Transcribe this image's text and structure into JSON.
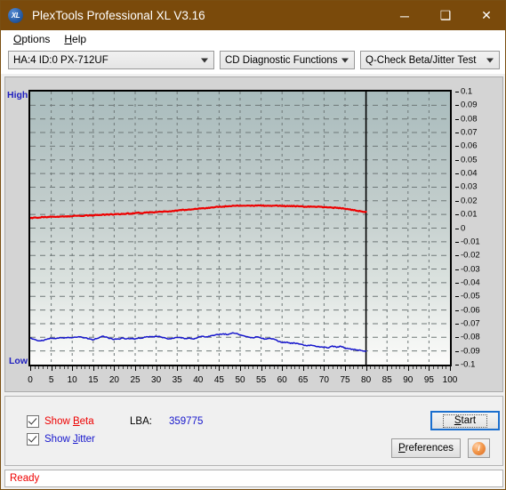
{
  "window": {
    "title": "PlexTools Professional XL V3.16",
    "icon": "xl-app-icon",
    "icon_text": "XL",
    "minimize_label": "─",
    "maximize_label": "❑",
    "close_label": "✕",
    "titlebar_color": "#7a4a0b"
  },
  "menu": {
    "items": [
      {
        "label": "Options",
        "accel": "O"
      },
      {
        "label": "Help",
        "accel": "H"
      }
    ]
  },
  "toolbar": {
    "drive_select": {
      "value": "HA:4 ID:0  PX-712UF",
      "options": [
        "HA:4 ID:0  PX-712UF"
      ]
    },
    "function_select": {
      "value": "CD Diagnostic Functions",
      "options": [
        "CD Diagnostic Functions"
      ]
    },
    "test_select": {
      "value": "Q-Check Beta/Jitter Test",
      "options": [
        "Q-Check Beta/Jitter Test"
      ]
    }
  },
  "controls": {
    "show_beta": {
      "label": "Show Beta",
      "accel": "B",
      "checked": true,
      "color": "#ee0000"
    },
    "show_jitter": {
      "label": "Show Jitter",
      "accel": "J",
      "checked": true,
      "color": "#1515cc"
    },
    "lba_label": "LBA:",
    "lba_value": "359775",
    "start_label": "Start",
    "start_accel": "S",
    "preferences_label": "Preferences",
    "preferences_accel": "P",
    "info_icon": "info-icon",
    "info_glyph": "i"
  },
  "status": {
    "text": "Ready"
  },
  "chart_data": {
    "type": "line",
    "title": "",
    "xlabel": "",
    "ylabel": "",
    "xlim": [
      0,
      100
    ],
    "ylim": [
      -0.1,
      0.1
    ],
    "grid": true,
    "legend": "none",
    "y_left_labels": {
      "top": "High",
      "bottom": "Low"
    },
    "x_ticks": [
      0,
      5,
      10,
      15,
      20,
      25,
      30,
      35,
      40,
      45,
      50,
      55,
      60,
      65,
      70,
      75,
      80,
      85,
      90,
      95,
      100
    ],
    "y_ticks": [
      0.1,
      0.09,
      0.08,
      0.07,
      0.06,
      0.05,
      0.04,
      0.03,
      0.02,
      0.01,
      0,
      -0.01,
      -0.02,
      -0.03,
      -0.04,
      -0.05,
      -0.06,
      -0.07,
      -0.08,
      -0.09,
      -0.1
    ],
    "data_end_marker_x": 80,
    "series": [
      {
        "name": "Beta",
        "color": "#ee0000",
        "x": [
          0,
          1,
          2,
          3,
          4,
          5,
          6,
          7,
          8,
          9,
          10,
          11,
          12,
          13,
          14,
          15,
          16,
          17,
          18,
          19,
          20,
          21,
          22,
          23,
          24,
          25,
          26,
          27,
          28,
          29,
          30,
          31,
          32,
          33,
          34,
          35,
          36,
          37,
          38,
          39,
          40,
          41,
          42,
          43,
          44,
          45,
          46,
          47,
          48,
          49,
          50,
          51,
          52,
          53,
          54,
          55,
          56,
          57,
          58,
          59,
          60,
          61,
          62,
          63,
          64,
          65,
          66,
          67,
          68,
          69,
          70,
          71,
          72,
          73,
          74,
          75,
          76,
          77,
          78,
          79,
          80
        ],
        "values": [
          0.0073,
          0.0078,
          0.0076,
          0.0081,
          0.0079,
          0.0083,
          0.0082,
          0.0085,
          0.0084,
          0.0088,
          0.0087,
          0.009,
          0.0089,
          0.0092,
          0.0094,
          0.0093,
          0.0097,
          0.0096,
          0.0099,
          0.0101,
          0.01,
          0.0104,
          0.0103,
          0.0107,
          0.0106,
          0.011,
          0.0112,
          0.0111,
          0.0115,
          0.0117,
          0.0116,
          0.012,
          0.0123,
          0.0122,
          0.0126,
          0.0128,
          0.0131,
          0.0134,
          0.0136,
          0.0139,
          0.0142,
          0.0145,
          0.0148,
          0.0151,
          0.0153,
          0.0156,
          0.0158,
          0.016,
          0.0161,
          0.0163,
          0.0164,
          0.0164,
          0.0165,
          0.0165,
          0.0164,
          0.0165,
          0.0164,
          0.0163,
          0.0164,
          0.0162,
          0.0163,
          0.0161,
          0.016,
          0.0161,
          0.0159,
          0.0158,
          0.0156,
          0.0157,
          0.0155,
          0.0156,
          0.0154,
          0.0152,
          0.015,
          0.0148,
          0.0145,
          0.0142,
          0.0137,
          0.0131,
          0.0126,
          0.0122,
          0.012
        ]
      },
      {
        "name": "Jitter",
        "color": "#1515cc",
        "x": [
          0,
          1,
          2,
          3,
          4,
          5,
          6,
          7,
          8,
          9,
          10,
          11,
          12,
          13,
          14,
          15,
          16,
          17,
          18,
          19,
          20,
          21,
          22,
          23,
          24,
          25,
          26,
          27,
          28,
          29,
          30,
          31,
          32,
          33,
          34,
          35,
          36,
          37,
          38,
          39,
          40,
          41,
          42,
          43,
          44,
          45,
          46,
          47,
          48,
          49,
          50,
          51,
          52,
          53,
          54,
          55,
          56,
          57,
          58,
          59,
          60,
          61,
          62,
          63,
          64,
          65,
          66,
          67,
          68,
          69,
          70,
          71,
          72,
          73,
          74,
          75,
          76,
          77,
          78,
          79,
          80
        ],
        "values": [
          -0.0805,
          -0.0815,
          -0.0826,
          -0.0824,
          -0.0814,
          -0.0808,
          -0.081,
          -0.0802,
          -0.0806,
          -0.0799,
          -0.0803,
          -0.08,
          -0.0796,
          -0.0804,
          -0.081,
          -0.0818,
          -0.0808,
          -0.0794,
          -0.0797,
          -0.0808,
          -0.0815,
          -0.0812,
          -0.0805,
          -0.0811,
          -0.0808,
          -0.0812,
          -0.0806,
          -0.0802,
          -0.0796,
          -0.0795,
          -0.0794,
          -0.0796,
          -0.0803,
          -0.0812,
          -0.0806,
          -0.0801,
          -0.0805,
          -0.0809,
          -0.0806,
          -0.0813,
          -0.08,
          -0.0792,
          -0.0796,
          -0.0788,
          -0.0784,
          -0.0779,
          -0.0774,
          -0.0781,
          -0.077,
          -0.0772,
          -0.0782,
          -0.079,
          -0.0798,
          -0.0803,
          -0.0797,
          -0.0806,
          -0.0813,
          -0.0808,
          -0.0812,
          -0.0829,
          -0.0838,
          -0.0836,
          -0.0845,
          -0.0842,
          -0.0849,
          -0.0855,
          -0.0862,
          -0.0858,
          -0.0866,
          -0.0872,
          -0.087,
          -0.0878,
          -0.0863,
          -0.0874,
          -0.0866,
          -0.0879,
          -0.0884,
          -0.089,
          -0.0893,
          -0.0897,
          -0.09
        ]
      }
    ]
  }
}
